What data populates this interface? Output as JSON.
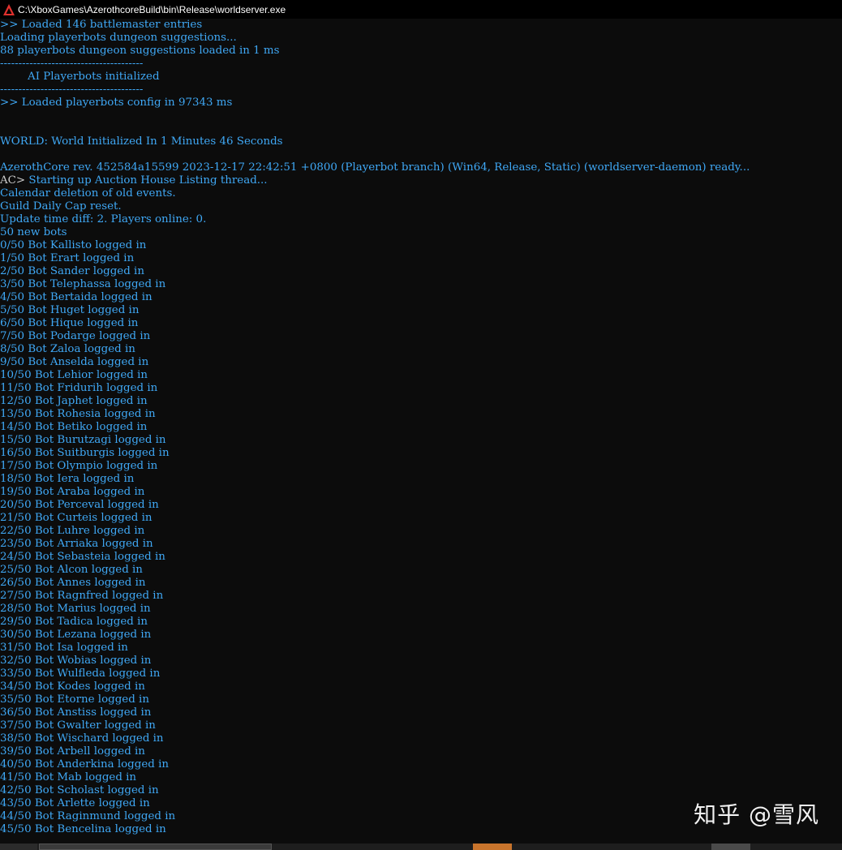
{
  "window": {
    "title": "C:\\XboxGames\\AzerothcoreBuild\\bin\\Release\\worldserver.exe",
    "icon": "azerothcore-app-icon",
    "colors": {
      "text": "#3fa8f5",
      "prompt": "#cccccc",
      "background": "#0c0c0c",
      "titlebar": "#000000"
    }
  },
  "console": {
    "lines": [
      {
        "prefix": "",
        "text": ">> Loaded 146 battlemaster entries"
      },
      {
        "prefix": "",
        "text": "Loading playerbots dungeon suggestions..."
      },
      {
        "prefix": "",
        "text": "88 playerbots dungeon suggestions loaded in 1 ms"
      },
      {
        "prefix": "",
        "text": "---------------------------------------"
      },
      {
        "prefix": "",
        "text": "        AI Playerbots initialized"
      },
      {
        "prefix": "",
        "text": "---------------------------------------"
      },
      {
        "prefix": "",
        "text": ">> Loaded playerbots config in 97343 ms"
      },
      {
        "prefix": "",
        "text": ""
      },
      {
        "prefix": "",
        "text": ""
      },
      {
        "prefix": "",
        "text": "WORLD: World Initialized In 1 Minutes 46 Seconds"
      },
      {
        "prefix": "",
        "text": ""
      },
      {
        "prefix": "",
        "text": "AzerothCore rev. 452584a15599 2023-12-17 22:42:51 +0800 (Playerbot branch) (Win64, Release, Static) (worldserver-daemon) ready..."
      },
      {
        "prefix": "AC>",
        "text": " Starting up Auction House Listing thread..."
      },
      {
        "prefix": "",
        "text": "Calendar deletion of old events."
      },
      {
        "prefix": "",
        "text": "Guild Daily Cap reset."
      },
      {
        "prefix": "",
        "text": "Update time diff: 2. Players online: 0."
      },
      {
        "prefix": "",
        "text": "50 new bots"
      },
      {
        "prefix": "",
        "text": "0/50 Bot Kallisto logged in"
      },
      {
        "prefix": "",
        "text": "1/50 Bot Erart logged in"
      },
      {
        "prefix": "",
        "text": "2/50 Bot Sander logged in"
      },
      {
        "prefix": "",
        "text": "3/50 Bot Telephassa logged in"
      },
      {
        "prefix": "",
        "text": "4/50 Bot Bertaida logged in"
      },
      {
        "prefix": "",
        "text": "5/50 Bot Huget logged in"
      },
      {
        "prefix": "",
        "text": "6/50 Bot Hique logged in"
      },
      {
        "prefix": "",
        "text": "7/50 Bot Podarge logged in"
      },
      {
        "prefix": "",
        "text": "8/50 Bot Zaloa logged in"
      },
      {
        "prefix": "",
        "text": "9/50 Bot Anselda logged in"
      },
      {
        "prefix": "",
        "text": "10/50 Bot Lehior logged in"
      },
      {
        "prefix": "",
        "text": "11/50 Bot Fridurih logged in"
      },
      {
        "prefix": "",
        "text": "12/50 Bot Japhet logged in"
      },
      {
        "prefix": "",
        "text": "13/50 Bot Rohesia logged in"
      },
      {
        "prefix": "",
        "text": "14/50 Bot Betiko logged in"
      },
      {
        "prefix": "",
        "text": "15/50 Bot Burutzagi logged in"
      },
      {
        "prefix": "",
        "text": "16/50 Bot Suitburgis logged in"
      },
      {
        "prefix": "",
        "text": "17/50 Bot Olympio logged in"
      },
      {
        "prefix": "",
        "text": "18/50 Bot Iera logged in"
      },
      {
        "prefix": "",
        "text": "19/50 Bot Araba logged in"
      },
      {
        "prefix": "",
        "text": "20/50 Bot Perceval logged in"
      },
      {
        "prefix": "",
        "text": "21/50 Bot Curteis logged in"
      },
      {
        "prefix": "",
        "text": "22/50 Bot Luhre logged in"
      },
      {
        "prefix": "",
        "text": "23/50 Bot Arriaka logged in"
      },
      {
        "prefix": "",
        "text": "24/50 Bot Sebasteia logged in"
      },
      {
        "prefix": "",
        "text": "25/50 Bot Alcon logged in"
      },
      {
        "prefix": "",
        "text": "26/50 Bot Annes logged in"
      },
      {
        "prefix": "",
        "text": "27/50 Bot Ragnfred logged in"
      },
      {
        "prefix": "",
        "text": "28/50 Bot Marius logged in"
      },
      {
        "prefix": "",
        "text": "29/50 Bot Tadica logged in"
      },
      {
        "prefix": "",
        "text": "30/50 Bot Lezana logged in"
      },
      {
        "prefix": "",
        "text": "31/50 Bot Isa logged in"
      },
      {
        "prefix": "",
        "text": "32/50 Bot Wobias logged in"
      },
      {
        "prefix": "",
        "text": "33/50 Bot Wulfleda logged in"
      },
      {
        "prefix": "",
        "text": "34/50 Bot Kodes logged in"
      },
      {
        "prefix": "",
        "text": "35/50 Bot Etorne logged in"
      },
      {
        "prefix": "",
        "text": "36/50 Bot Anstiss logged in"
      },
      {
        "prefix": "",
        "text": "37/50 Bot Gwalter logged in"
      },
      {
        "prefix": "",
        "text": "38/50 Bot Wischard logged in"
      },
      {
        "prefix": "",
        "text": "39/50 Bot Arbell logged in"
      },
      {
        "prefix": "",
        "text": "40/50 Bot Anderkina logged in"
      },
      {
        "prefix": "",
        "text": "41/50 Bot Mab logged in"
      },
      {
        "prefix": "",
        "text": "42/50 Bot Scholast logged in"
      },
      {
        "prefix": "",
        "text": "43/50 Bot Arlette logged in"
      },
      {
        "prefix": "",
        "text": "44/50 Bot Raginmund logged in"
      },
      {
        "prefix": "",
        "text": "45/50 Bot Bencelina logged in"
      }
    ]
  },
  "watermark": {
    "text": "知乎 @雪风"
  },
  "taskbar": {
    "segments": [
      {
        "name": "taskbar-segment-1",
        "color": "#2b2b2b"
      },
      {
        "name": "taskbar-segment-2",
        "color": "#3a3a3a"
      },
      {
        "name": "taskbar-segment-active",
        "color": "#c8742c"
      },
      {
        "name": "taskbar-segment-3",
        "color": "#4a4a4a"
      }
    ]
  }
}
